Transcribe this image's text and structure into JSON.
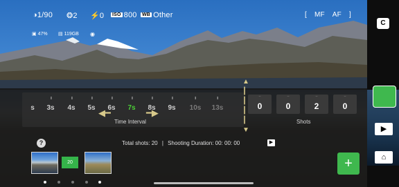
{
  "status_bar": {
    "shutter": "1/90",
    "ev": "2",
    "flash": "0",
    "iso_badge": "ISO",
    "iso": "800",
    "wb_badge": "WB",
    "wb": "Other",
    "focus_left": "[",
    "mf": "MF",
    "af": "AF",
    "focus_right": "]"
  },
  "sub_status": {
    "battery": "47%",
    "storage": "119GB"
  },
  "side_buttons": {
    "top_label": "C",
    "play_icon": "play-icon",
    "home_icon": "home-icon"
  },
  "time_interval": {
    "label": "Time Interval",
    "ticks": [
      "s",
      "3s",
      "4s",
      "5s",
      "6s",
      "7s",
      "8s",
      "9s",
      "10s",
      "13s"
    ],
    "selected": "7s"
  },
  "shots": {
    "label": "Shots",
    "digits": [
      "0",
      "0",
      "2",
      "0"
    ]
  },
  "summary": {
    "total_label": "Total shots:",
    "total_value": "20",
    "separator": "|",
    "duration_label": "Shooting Duration:",
    "duration_value": "00: 00: 00"
  },
  "sequence": {
    "interval_value": "20",
    "help": "?",
    "add": "+"
  },
  "colors": {
    "accent_green": "#3fb84e",
    "active_tick": "#4cd137",
    "arrow_color": "#d7c98a"
  }
}
